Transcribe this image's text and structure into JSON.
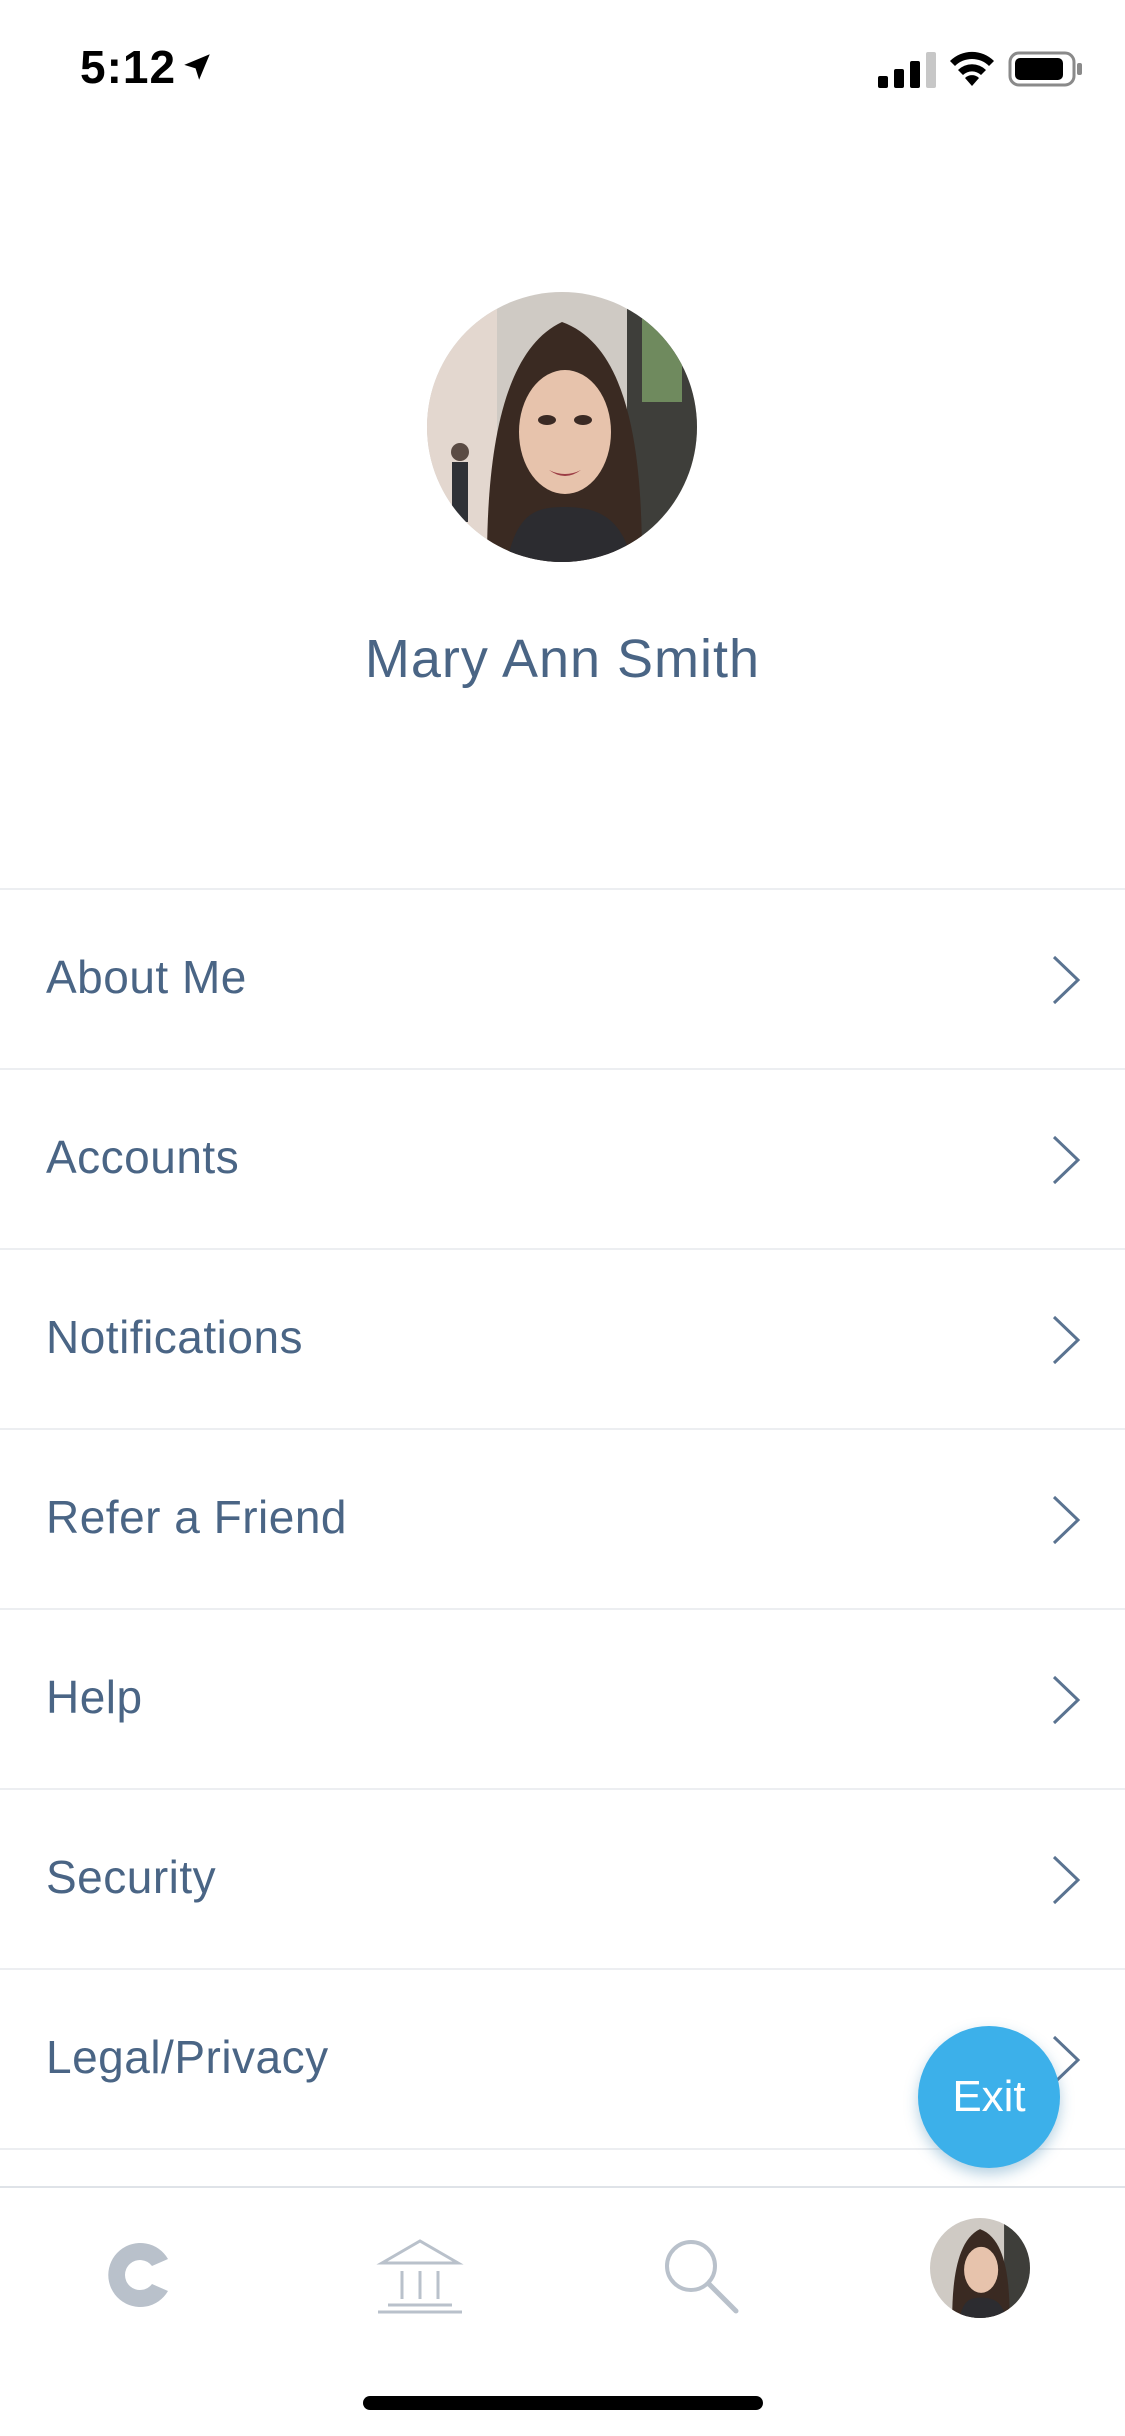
{
  "status_bar": {
    "time": "5:12",
    "icons": [
      "location-arrow-icon",
      "cellular-signal-icon",
      "wifi-icon",
      "battery-icon"
    ]
  },
  "profile": {
    "name": "Mary Ann Smith",
    "avatar": "profile-photo"
  },
  "menu": {
    "items": [
      {
        "label": "About Me"
      },
      {
        "label": "Accounts"
      },
      {
        "label": "Notifications"
      },
      {
        "label": "Refer a Friend"
      },
      {
        "label": "Help"
      },
      {
        "label": "Security"
      },
      {
        "label": "Legal/Privacy"
      }
    ]
  },
  "exit_button": {
    "label": "Exit"
  },
  "tab_bar": {
    "items": [
      "home-logo-icon",
      "bank-icon",
      "search-icon",
      "profile-avatar"
    ]
  },
  "colors": {
    "text": "#4a6585",
    "accent": "#3cb0ea",
    "divider": "#eceef1",
    "tab_icon": "#b9c1cb"
  }
}
